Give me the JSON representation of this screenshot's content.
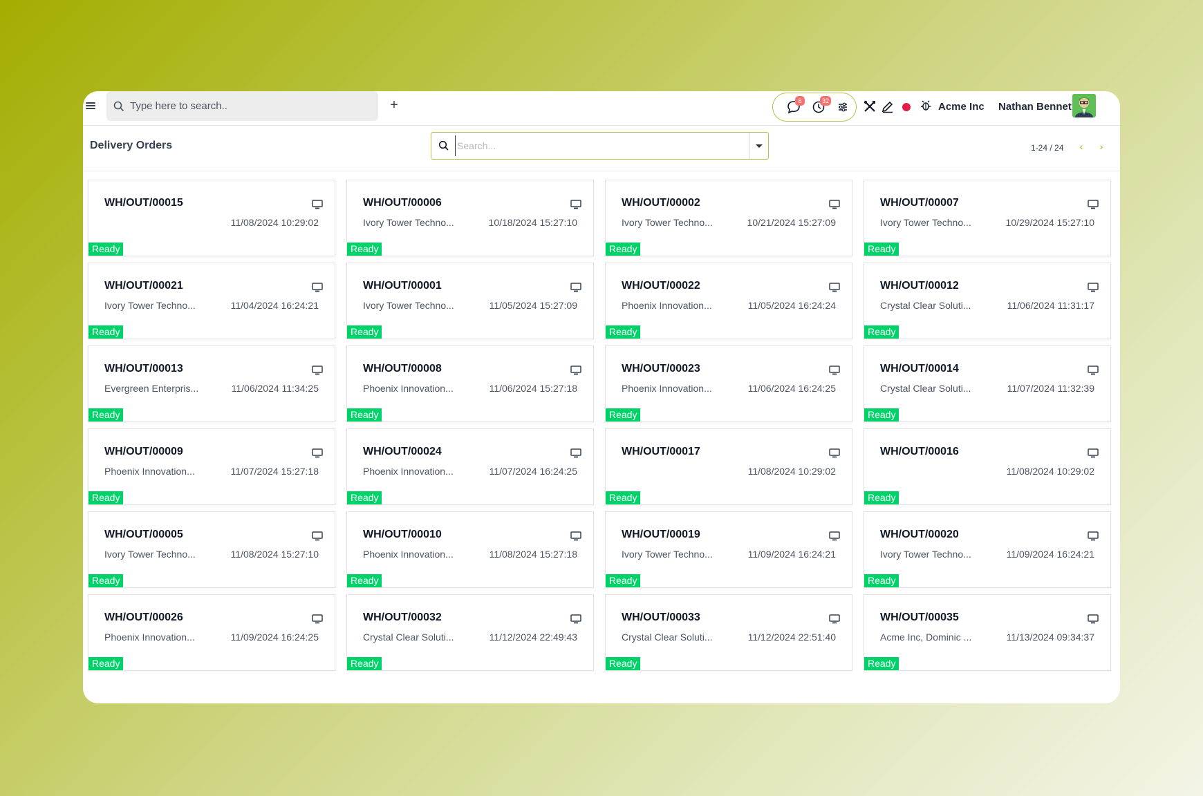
{
  "topbar": {
    "search_placeholder": "Type here to search..",
    "add_label": "+",
    "messages_count": "6",
    "activities_count": "32",
    "company": "Acme Inc",
    "user": "Nathan Bennet"
  },
  "header": {
    "title": "Delivery Orders",
    "search_placeholder": "Search...",
    "pager": "1-24 / 24",
    "prev": "‹",
    "next": "›"
  },
  "status_colors": {
    "ready": "#00d26a",
    "accent": "#b9c14a"
  },
  "cards": [
    {
      "ref": "WH/OUT/00015",
      "partner": "",
      "date": "11/08/2024 10:29:02",
      "status": "Ready"
    },
    {
      "ref": "WH/OUT/00006",
      "partner": "Ivory Tower Techno...",
      "date": "10/18/2024 15:27:10",
      "status": "Ready"
    },
    {
      "ref": "WH/OUT/00002",
      "partner": "Ivory Tower Techno...",
      "date": "10/21/2024 15:27:09",
      "status": "Ready"
    },
    {
      "ref": "WH/OUT/00007",
      "partner": "Ivory Tower Techno...",
      "date": "10/29/2024 15:27:10",
      "status": "Ready"
    },
    {
      "ref": "WH/OUT/00021",
      "partner": "Ivory Tower Techno...",
      "date": "11/04/2024 16:24:21",
      "status": "Ready"
    },
    {
      "ref": "WH/OUT/00001",
      "partner": "Ivory Tower Techno...",
      "date": "11/05/2024 15:27:09",
      "status": "Ready"
    },
    {
      "ref": "WH/OUT/00022",
      "partner": "Phoenix Innovation...",
      "date": "11/05/2024 16:24:24",
      "status": "Ready"
    },
    {
      "ref": "WH/OUT/00012",
      "partner": "Crystal Clear Soluti...",
      "date": "11/06/2024 11:31:17",
      "status": "Ready"
    },
    {
      "ref": "WH/OUT/00013",
      "partner": "Evergreen Enterpris...",
      "date": "11/06/2024 11:34:25",
      "status": "Ready"
    },
    {
      "ref": "WH/OUT/00008",
      "partner": "Phoenix Innovation...",
      "date": "11/06/2024 15:27:18",
      "status": "Ready"
    },
    {
      "ref": "WH/OUT/00023",
      "partner": "Phoenix Innovation...",
      "date": "11/06/2024 16:24:25",
      "status": "Ready"
    },
    {
      "ref": "WH/OUT/00014",
      "partner": "Crystal Clear Soluti...",
      "date": "11/07/2024 11:32:39",
      "status": "Ready"
    },
    {
      "ref": "WH/OUT/00009",
      "partner": "Phoenix Innovation...",
      "date": "11/07/2024 15:27:18",
      "status": "Ready"
    },
    {
      "ref": "WH/OUT/00024",
      "partner": "Phoenix Innovation...",
      "date": "11/07/2024 16:24:25",
      "status": "Ready"
    },
    {
      "ref": "WH/OUT/00017",
      "partner": "",
      "date": "11/08/2024 10:29:02",
      "status": "Ready"
    },
    {
      "ref": "WH/OUT/00016",
      "partner": "",
      "date": "11/08/2024 10:29:02",
      "status": "Ready"
    },
    {
      "ref": "WH/OUT/00005",
      "partner": "Ivory Tower Techno...",
      "date": "11/08/2024 15:27:10",
      "status": "Ready"
    },
    {
      "ref": "WH/OUT/00010",
      "partner": "Phoenix Innovation...",
      "date": "11/08/2024 15:27:18",
      "status": "Ready"
    },
    {
      "ref": "WH/OUT/00019",
      "partner": "Ivory Tower Techno...",
      "date": "11/09/2024 16:24:21",
      "status": "Ready"
    },
    {
      "ref": "WH/OUT/00020",
      "partner": "Ivory Tower Techno...",
      "date": "11/09/2024 16:24:21",
      "status": "Ready"
    },
    {
      "ref": "WH/OUT/00026",
      "partner": "Phoenix Innovation...",
      "date": "11/09/2024 16:24:25",
      "status": "Ready"
    },
    {
      "ref": "WH/OUT/00032",
      "partner": "Crystal Clear Soluti...",
      "date": "11/12/2024 22:49:43",
      "status": "Ready"
    },
    {
      "ref": "WH/OUT/00033",
      "partner": "Crystal Clear Soluti...",
      "date": "11/12/2024 22:51:40",
      "status": "Ready"
    },
    {
      "ref": "WH/OUT/00035",
      "partner": "Acme Inc, Dominic ...",
      "date": "11/13/2024 09:34:37",
      "status": "Ready"
    }
  ]
}
